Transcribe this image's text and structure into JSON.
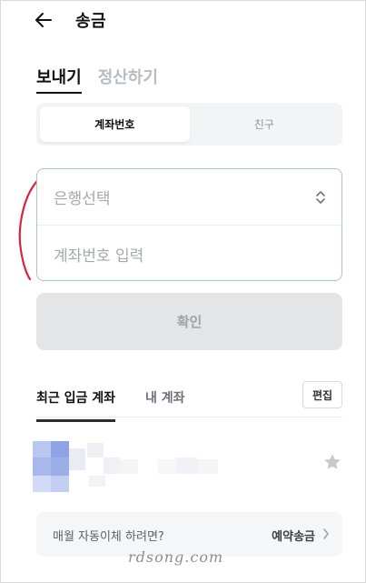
{
  "header": {
    "back_icon": "arrow-left-icon",
    "title": "송금"
  },
  "mode_tabs": [
    {
      "label": "보내기",
      "active": true
    },
    {
      "label": "정산하기",
      "active": false
    }
  ],
  "segment": [
    {
      "label": "계좌번호",
      "active": true
    },
    {
      "label": "친구",
      "active": false
    }
  ],
  "form": {
    "bank_placeholder": "은행선택",
    "bank_icon": "chevron-updown-icon",
    "account_placeholder": "계좌번호 입력"
  },
  "confirm_label": "확인",
  "recent": {
    "tabs": [
      {
        "label": "최근 입금 계좌",
        "active": true
      },
      {
        "label": "내 계좌",
        "active": false
      }
    ],
    "edit_label": "편집",
    "star_icon": "star-icon"
  },
  "banner": {
    "text": "매월 자동이체 하려면?",
    "link": "예약송금",
    "icon": "chevron-right-icon"
  },
  "watermark": "rdsong.com",
  "colors": {
    "accent_border": "#a9c7be",
    "annotation_red": "#d7263d",
    "disabled_button": "#e3e5e7"
  }
}
